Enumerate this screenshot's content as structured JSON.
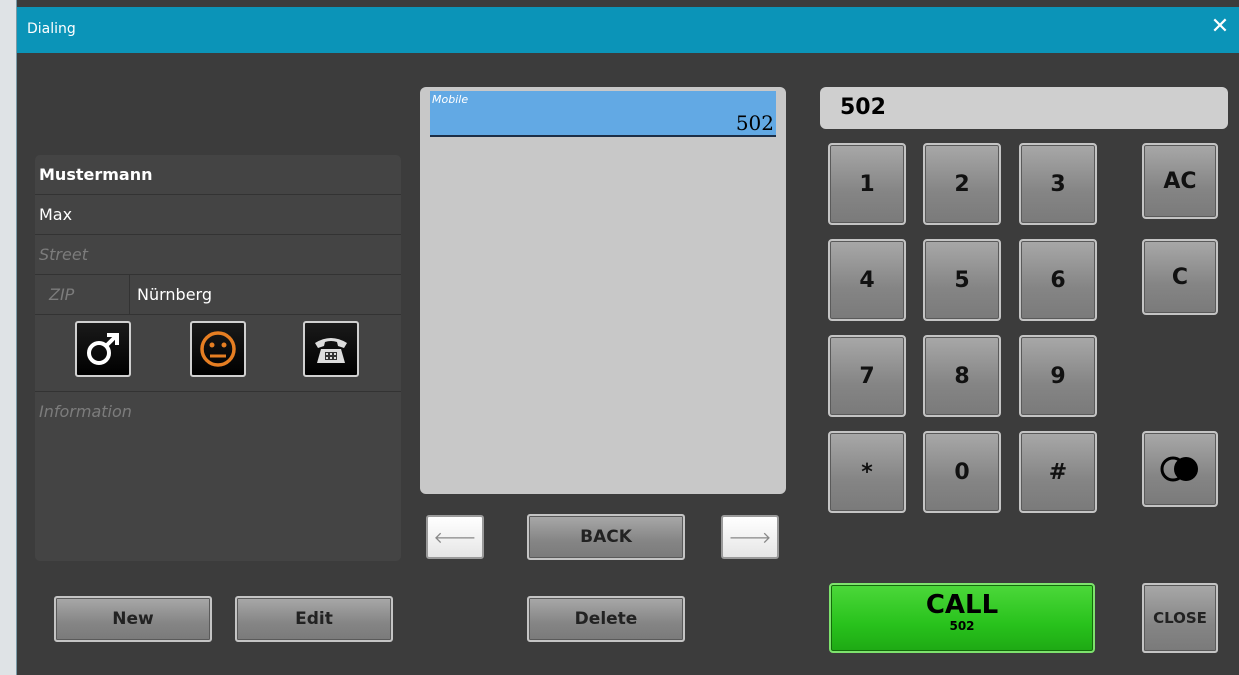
{
  "window": {
    "title": "Dialing",
    "close_icon": "close-icon"
  },
  "contact": {
    "last_name": "Mustermann",
    "first_name": "Max",
    "street_placeholder": "Street",
    "zip_placeholder": "ZIP",
    "city": "Nürnberg",
    "info_placeholder": "Information",
    "icons": [
      "male-gender-icon",
      "neutral-face-icon",
      "telephone-icon"
    ],
    "accent_color": "#e67e22"
  },
  "numbers": {
    "items": [
      {
        "type": "Mobile",
        "number": "502",
        "selected": true
      }
    ],
    "selected_color": "#62a9e4"
  },
  "nav": {
    "back_label": "BACK",
    "prev_icon": "arrow-left-icon",
    "next_icon": "arrow-right-icon"
  },
  "display": {
    "value": "502"
  },
  "keypad": {
    "keys": [
      "1",
      "2",
      "3",
      "4",
      "5",
      "6",
      "7",
      "8",
      "9",
      "*",
      "0",
      "#"
    ],
    "ac_label": "AC",
    "c_label": "C",
    "toggle_icon": "circles-toggle-icon"
  },
  "actions": {
    "new_label": "New",
    "edit_label": "Edit",
    "delete_label": "Delete",
    "call_label": "CALL",
    "call_number": "502",
    "close_label": "CLOSE",
    "call_color": "#28c21c"
  }
}
